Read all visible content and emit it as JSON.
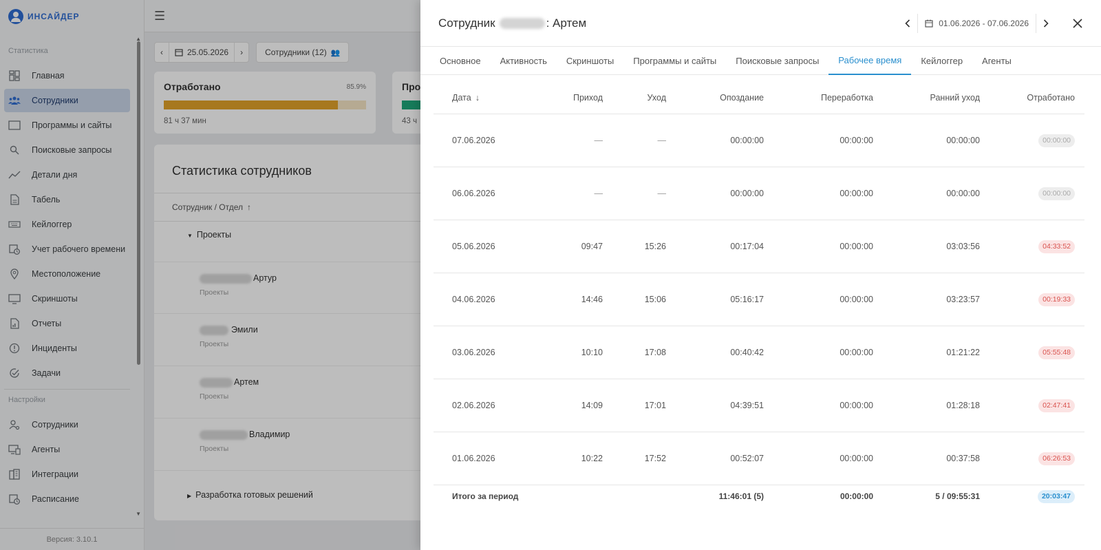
{
  "app": {
    "logo_text": "ИНСАЙДЕР",
    "version": "Версия: 3.10.1"
  },
  "sidebar": {
    "section_stats": "Статистика",
    "section_settings": "Настройки",
    "items": [
      {
        "label": "Главная",
        "icon": "dashboard-icon"
      },
      {
        "label": "Сотрудники",
        "icon": "users-icon"
      },
      {
        "label": "Программы и сайты",
        "icon": "monitor-icon"
      },
      {
        "label": "Поисковые запросы",
        "icon": "search-icon"
      },
      {
        "label": "Детали дня",
        "icon": "chart-line-icon"
      },
      {
        "label": "Табель",
        "icon": "document-icon"
      },
      {
        "label": "Кейлоггер",
        "icon": "keyboard-icon"
      },
      {
        "label": "Учет рабочего времени",
        "icon": "calendar-clock-icon"
      },
      {
        "label": "Местоположение",
        "icon": "location-pin-icon"
      },
      {
        "label": "Скриншоты",
        "icon": "screenshot-icon"
      },
      {
        "label": "Отчеты",
        "icon": "report-icon"
      },
      {
        "label": "Инциденты",
        "icon": "alert-circle-icon"
      },
      {
        "label": "Задачи",
        "icon": "check-circle-icon"
      }
    ],
    "settings_items": [
      {
        "label": "Сотрудники",
        "icon": "user-settings-icon"
      },
      {
        "label": "Агенты",
        "icon": "agents-icon"
      },
      {
        "label": "Интеграции",
        "icon": "integrations-icon"
      },
      {
        "label": "Расписание",
        "icon": "schedule-icon"
      }
    ]
  },
  "main": {
    "date": "25.05.2026",
    "employees_button": "Сотрудники (12)",
    "card1": {
      "title": "Отработано",
      "percent": "85.9%",
      "percent_value": 85.9,
      "sub": "81 ч 37 мин"
    },
    "card2": {
      "title": "Про",
      "sub": "43 ч"
    },
    "stats_title": "Статистика сотрудников",
    "stats_header": "Сотрудник / Отдел",
    "group1": "Проекты",
    "group2": "Разработка готовых решений",
    "employees": [
      {
        "name": "Артур",
        "dept": "Проекты"
      },
      {
        "name": "Эмили",
        "dept": "Проекты"
      },
      {
        "name": "Артем",
        "dept": "Проекты"
      },
      {
        "name": "Владимир",
        "dept": "Проекты"
      }
    ]
  },
  "panel": {
    "title_prefix": "Сотрудник",
    "title_suffix": ": Артем",
    "date_range": "01.06.2026 - 07.06.2026",
    "tabs": [
      "Основное",
      "Активность",
      "Скриншоты",
      "Программы и сайты",
      "Поисковые запросы",
      "Рабочее время",
      "Кейлоггер",
      "Агенты"
    ],
    "active_tab": "Рабочее время",
    "columns": {
      "date": "Дата",
      "arrival": "Приход",
      "leave": "Уход",
      "late": "Опоздание",
      "overtime": "Переработка",
      "early": "Ранний уход",
      "worked": "Отработано"
    },
    "rows": [
      {
        "date": "07.06.2026",
        "arrival": "—",
        "leave": "—",
        "late": "00:00:00",
        "overtime": "00:00:00",
        "early": "00:00:00",
        "worked": "00:00:00",
        "status": "grey"
      },
      {
        "date": "06.06.2026",
        "arrival": "—",
        "leave": "—",
        "late": "00:00:00",
        "overtime": "00:00:00",
        "early": "00:00:00",
        "worked": "00:00:00",
        "status": "grey"
      },
      {
        "date": "05.06.2026",
        "arrival": "09:47",
        "leave": "15:26",
        "late": "00:17:04",
        "overtime": "00:00:00",
        "early": "03:03:56",
        "worked": "04:33:52",
        "status": "red"
      },
      {
        "date": "04.06.2026",
        "arrival": "14:46",
        "leave": "15:06",
        "late": "05:16:17",
        "overtime": "00:00:00",
        "early": "03:23:57",
        "worked": "00:19:33",
        "status": "red"
      },
      {
        "date": "03.06.2026",
        "arrival": "10:10",
        "leave": "17:08",
        "late": "00:40:42",
        "overtime": "00:00:00",
        "early": "01:21:22",
        "worked": "05:55:48",
        "status": "red"
      },
      {
        "date": "02.06.2026",
        "arrival": "14:09",
        "leave": "17:01",
        "late": "04:39:51",
        "overtime": "00:00:00",
        "early": "01:28:18",
        "worked": "02:47:41",
        "status": "red"
      },
      {
        "date": "01.06.2026",
        "arrival": "10:22",
        "leave": "17:52",
        "late": "00:52:07",
        "overtime": "00:00:00",
        "early": "00:37:58",
        "worked": "06:26:53",
        "status": "red"
      }
    ],
    "total": {
      "label": "Итого за период",
      "late": "11:46:01 (5)",
      "overtime": "00:00:00",
      "early": "5 / 09:55:31",
      "worked": "20:03:47"
    }
  }
}
